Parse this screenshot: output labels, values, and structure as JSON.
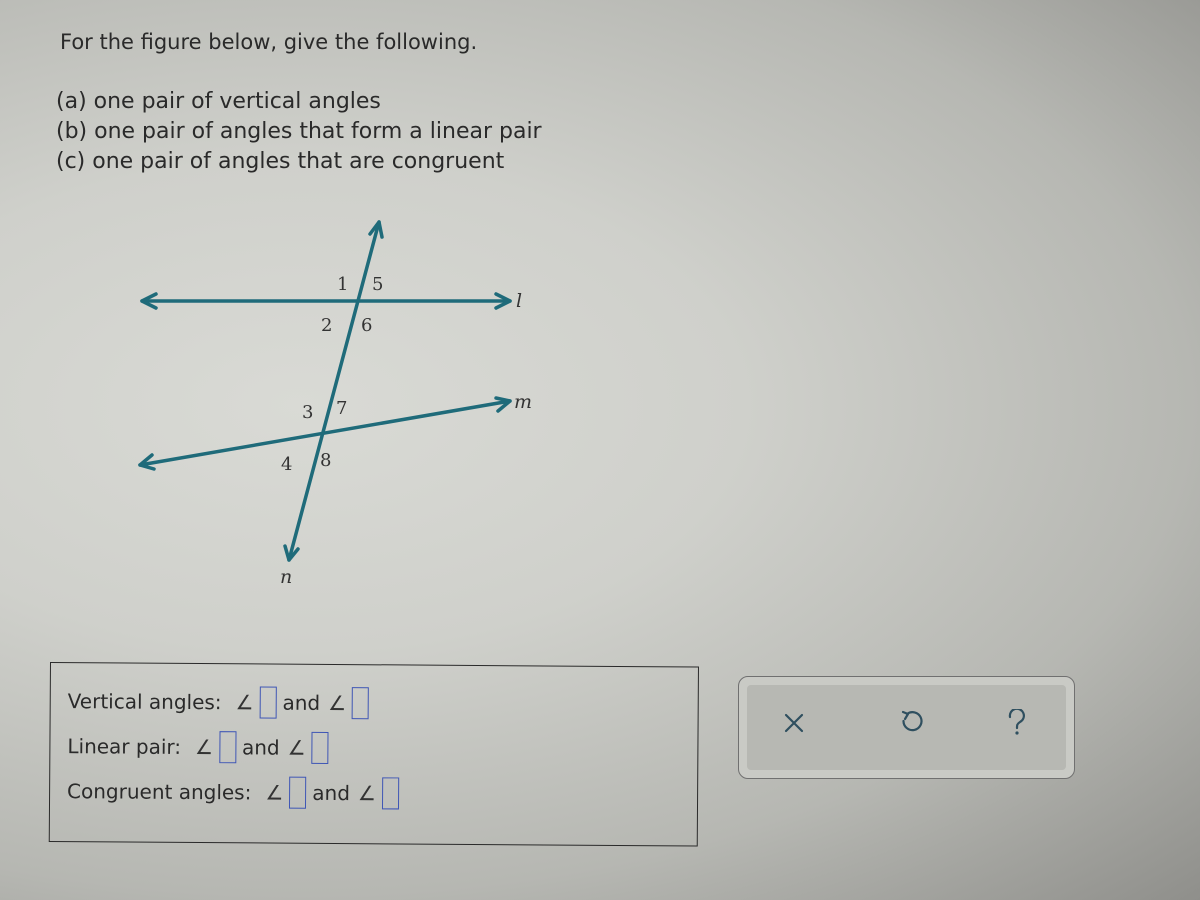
{
  "prompt": "For the figure below, give the following.",
  "parts": [
    "(a) one pair of vertical angles",
    "(b) one pair of angles that form a linear pair",
    "(c) one pair of angles that are congruent"
  ],
  "figure": {
    "line_color": "#1f6b7a",
    "line_labels": {
      "l": "l",
      "m": "m",
      "n": "n"
    },
    "angle_labels": [
      "1",
      "2",
      "3",
      "4",
      "5",
      "6",
      "7",
      "8"
    ]
  },
  "answers": {
    "angle_symbol": "∠",
    "connector": "and",
    "rows": [
      {
        "label": "Vertical angles:",
        "first": "",
        "second": ""
      },
      {
        "label": "Linear pair:",
        "first": "",
        "second": ""
      },
      {
        "label": "Congruent angles:",
        "first": "",
        "second": ""
      }
    ]
  },
  "toolbar": {
    "clear_icon": "x-icon",
    "undo_icon": "undo-icon",
    "help_icon": "help-icon",
    "icon_color": "#2f4f5f"
  }
}
